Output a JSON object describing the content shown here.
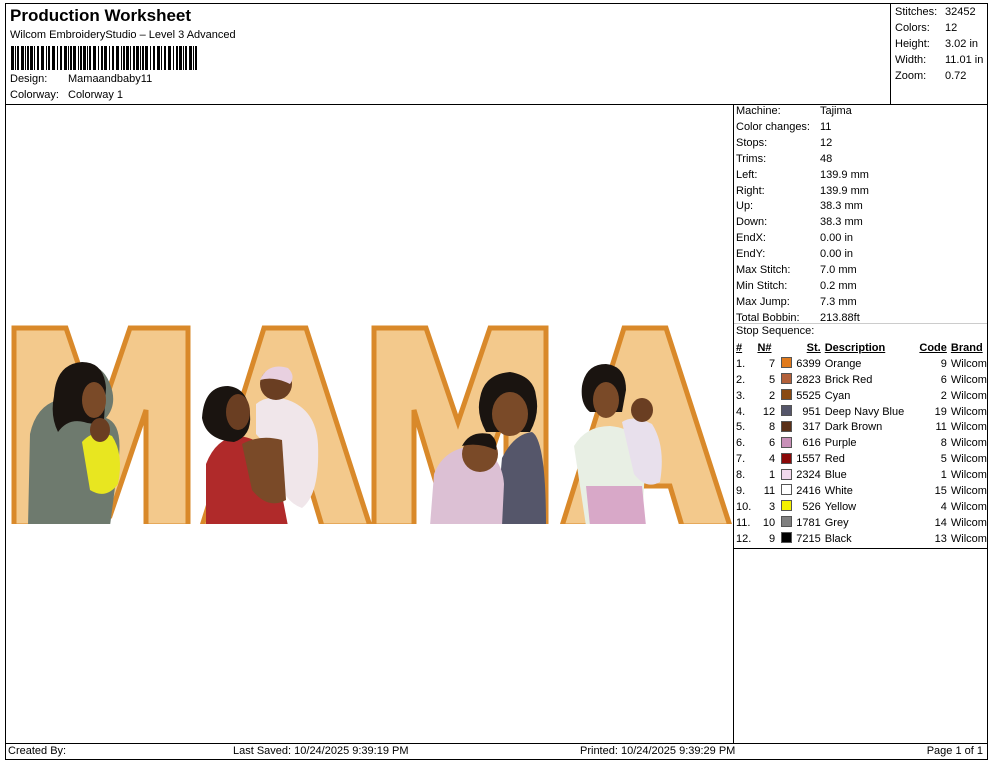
{
  "header": {
    "title": "Production Worksheet",
    "subtitle": "Wilcom EmbroideryStudio – Level 3 Advanced",
    "design_label": "Design:",
    "design_value": "Mamaandbaby11",
    "colorway_label": "Colorway:",
    "colorway_value": "Colorway 1"
  },
  "summary": [
    {
      "k": "Stitches:",
      "v": "32452"
    },
    {
      "k": "Colors:",
      "v": "12"
    },
    {
      "k": "Height:",
      "v": "3.02 in"
    },
    {
      "k": "Width:",
      "v": "11.01 in"
    },
    {
      "k": "Zoom:",
      "v": "0.72"
    }
  ],
  "machine": [
    {
      "k": "Machine:",
      "v": "Tajima"
    },
    {
      "k": "Color changes:",
      "v": "11"
    },
    {
      "k": "Stops:",
      "v": "12"
    },
    {
      "k": "Trims:",
      "v": "48"
    },
    {
      "k": "Left:",
      "v": "139.9 mm"
    },
    {
      "k": "Right:",
      "v": "139.9 mm"
    },
    {
      "k": "Up:",
      "v": "38.3 mm"
    },
    {
      "k": "Down:",
      "v": "38.3 mm"
    },
    {
      "k": "EndX:",
      "v": "0.00 in"
    },
    {
      "k": "EndY:",
      "v": "0.00 in"
    },
    {
      "k": "Max Stitch:",
      "v": "7.0 mm"
    },
    {
      "k": "Min Stitch:",
      "v": "0.2 mm"
    },
    {
      "k": "Max Jump:",
      "v": "7.3 mm"
    },
    {
      "k": "Total Bobbin:",
      "v": "213.88ft"
    }
  ],
  "stop_sequence": {
    "title": "Stop Sequence:",
    "headers": {
      "idx": "#",
      "n": "N#",
      "st": "St.",
      "desc": "Description",
      "code": "Code",
      "brand": "Brand"
    },
    "rows": [
      {
        "idx": "1.",
        "n": "7",
        "color": "#e07a1c",
        "st": "6399",
        "desc": "Orange",
        "code": "9",
        "brand": "Wilcom"
      },
      {
        "idx": "2.",
        "n": "5",
        "color": "#b2603a",
        "st": "2823",
        "desc": "Brick Red",
        "code": "6",
        "brand": "Wilcom"
      },
      {
        "idx": "3.",
        "n": "2",
        "color": "#8a4a12",
        "st": "5525",
        "desc": "Cyan",
        "code": "2",
        "brand": "Wilcom"
      },
      {
        "idx": "4.",
        "n": "12",
        "color": "#55566a",
        "st": "951",
        "desc": "Deep Navy Blue",
        "code": "19",
        "brand": "Wilcom"
      },
      {
        "idx": "5.",
        "n": "8",
        "color": "#5a3018",
        "st": "317",
        "desc": "Dark Brown",
        "code": "11",
        "brand": "Wilcom"
      },
      {
        "idx": "6.",
        "n": "6",
        "color": "#c890b8",
        "st": "616",
        "desc": "Purple",
        "code": "8",
        "brand": "Wilcom"
      },
      {
        "idx": "7.",
        "n": "4",
        "color": "#8a0808",
        "st": "1557",
        "desc": "Red",
        "code": "5",
        "brand": "Wilcom"
      },
      {
        "idx": "8.",
        "n": "1",
        "color": "#f2d8ec",
        "st": "2324",
        "desc": "Blue",
        "code": "1",
        "brand": "Wilcom"
      },
      {
        "idx": "9.",
        "n": "11",
        "color": "#ffffff",
        "st": "2416",
        "desc": "White",
        "code": "15",
        "brand": "Wilcom"
      },
      {
        "idx": "10.",
        "n": "3",
        "color": "#f4f000",
        "st": "526",
        "desc": "Yellow",
        "code": "4",
        "brand": "Wilcom"
      },
      {
        "idx": "11.",
        "n": "10",
        "color": "#808080",
        "st": "1781",
        "desc": "Grey",
        "code": "14",
        "brand": "Wilcom"
      },
      {
        "idx": "12.",
        "n": "9",
        "color": "#000000",
        "st": "7215",
        "desc": "Black",
        "code": "13",
        "brand": "Wilcom"
      }
    ]
  },
  "footer": {
    "created_by": "Created By:",
    "last_saved": "Last Saved: 10/24/2025 9:39:19 PM",
    "printed": "Printed: 10/24/2025 9:39:29 PM",
    "page": "Page 1 of 1"
  },
  "colors": {
    "letter_fill": "#f3c98c",
    "letter_stroke": "#d9892a"
  }
}
